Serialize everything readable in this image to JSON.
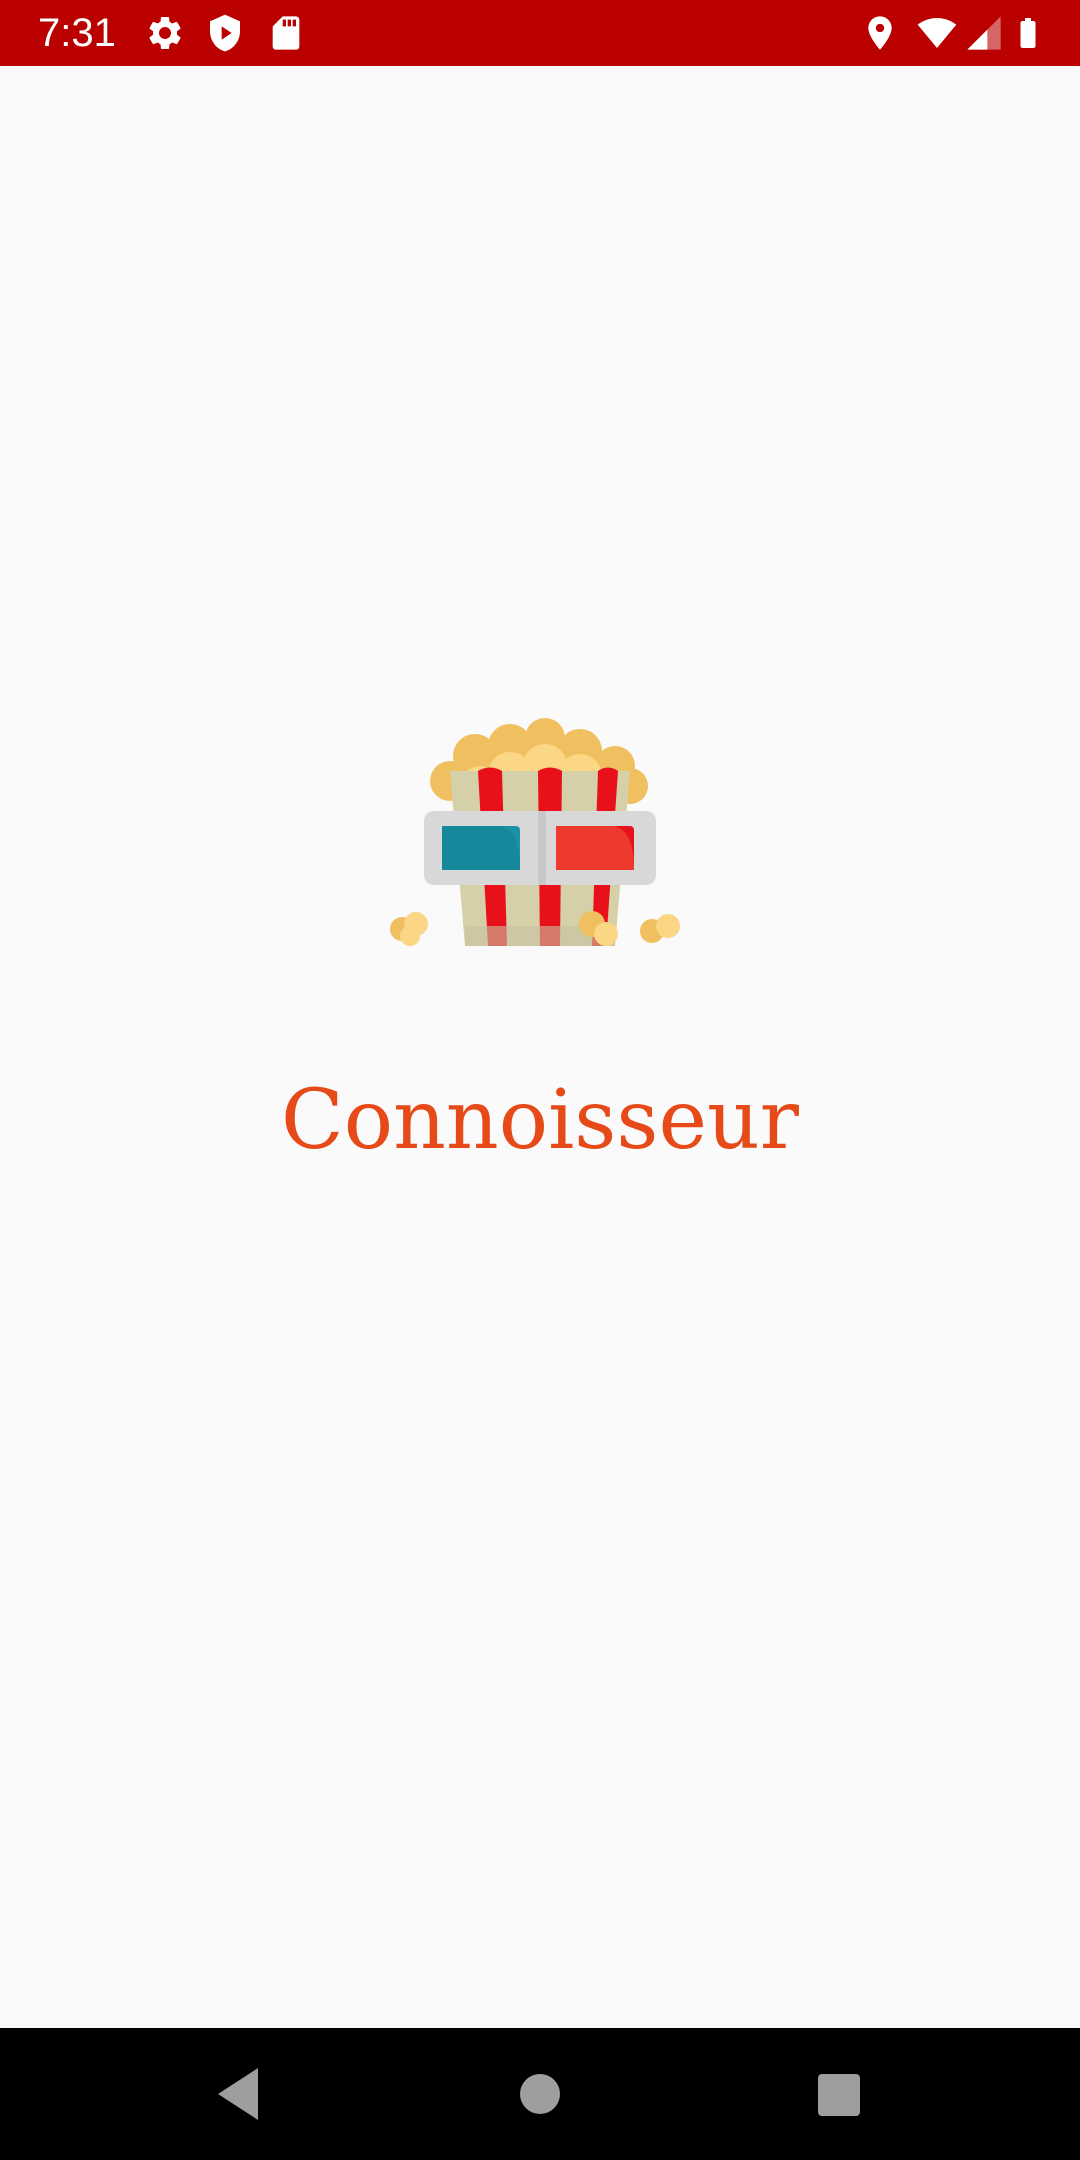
{
  "status_bar": {
    "time": "7:31",
    "background": "#bb0000",
    "left_icons": [
      "settings-gear-icon",
      "shield-icon",
      "sd-card-icon"
    ],
    "right_icons": [
      "location-pin-icon",
      "wifi-icon",
      "cellular-signal-icon",
      "battery-icon"
    ]
  },
  "splash": {
    "logo_icon": "popcorn-3d-glasses-icon",
    "app_name": "Connoisseur",
    "app_name_color": "#e64a19",
    "background": "#fafafa"
  },
  "nav_bar": {
    "buttons": [
      "back-icon",
      "home-icon",
      "recents-icon"
    ]
  }
}
